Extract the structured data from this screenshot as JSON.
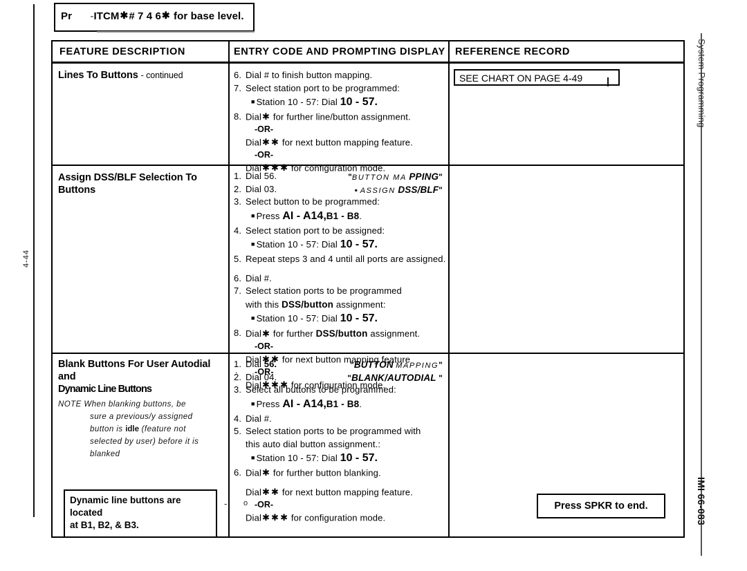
{
  "document": {
    "running_head": "System Programming",
    "doc_code": "IMI 66-083",
    "page_marker": "4-44"
  },
  "top_callout": {
    "prefix": "Pr",
    "faded": "‐",
    "text": "ITCM",
    "code": "# 7 4 6",
    "suffix": "for base level."
  },
  "table": {
    "headers": {
      "feature": "FEATURE DESCRIPTION",
      "entry": "ENTRY CODE AND PROMPTING DISPLAY",
      "reference": "REFERENCE RECORD"
    },
    "rows": [
      {
        "feature_title": "Lines To Buttons",
        "feature_suffix": "- continued",
        "steps": [
          {
            "num": "6.",
            "text": "Dial # to finish button mapping."
          },
          {
            "num": "7.",
            "text": "Select station port to be programmed:"
          },
          {
            "sub": "Station 10 - 57: Dial",
            "sub_big": "10 - 57."
          },
          {
            "num": "8.",
            "pre": "Dial",
            "ast": 1,
            "post": "for further line/button assignment."
          },
          {
            "or": "-OR-"
          },
          {
            "cont_pre": "Dial",
            "cont_ast": 2,
            "cont_post": "for next button mapping feature."
          },
          {
            "or": "-OR-"
          },
          {
            "cont_pre": "Dial",
            "cont_ast": 3,
            "cont_post": "for configuration mode."
          }
        ],
        "reference": "SEE CHART ON PAGE 4-49"
      },
      {
        "feature_title": "Assign DSS/BLF Selection To Buttons",
        "steps": [
          {
            "num": "1.",
            "text": "Dial 56.",
            "prompt_quote": "\"",
            "prompt_small": "BUTTON MA",
            "prompt_large": "PPING",
            "prompt_quote2": "\""
          },
          {
            "num": "2.",
            "text": "Dial 03.",
            "prompt_quote": "▪",
            "prompt_small": "ASSIGN",
            "prompt_large": "DSS/BLF",
            "prompt_quote2": "\""
          },
          {
            "num": "3.",
            "text": "Select button to be programmed:"
          },
          {
            "sub_press": "Press",
            "sub_big2": "AI - A14,",
            "sub_bold": "B1 - B8",
            "sub_end": "."
          },
          {
            "num": "4.",
            "text": "Select station port to be assigned:"
          },
          {
            "sub": "Station 10 - 57: Dial",
            "sub_big": "10 - 57."
          },
          {
            "num": "5.",
            "text": "Repeat steps 3 and 4 until all ports are assigned."
          },
          {
            "spacer": true
          },
          {
            "num": "6.",
            "text": "Dial #."
          },
          {
            "num": "7.",
            "text": "Select station ports to be programmed"
          },
          {
            "cont2_pre": "with this",
            "cont2_bold": "DSS/button",
            "cont2_post": "assignment:"
          },
          {
            "sub": "Station 10 - 57: Dial",
            "sub_big": "10 - 57."
          },
          {
            "num": "8.",
            "pre": "Dial",
            "ast": 1,
            "mid_bold": "DSS/button",
            "post_b": "for further",
            "post": "assignment."
          },
          {
            "or": "-OR-"
          },
          {
            "cont_pre": "Dial",
            "cont_ast": 2,
            "cont_post": "for next button mapping feature"
          },
          {
            "or_dot": "-OR-"
          },
          {
            "cont_pre": "Dial",
            "cont_ast": 3,
            "cont_post": "for configuration mode."
          }
        ],
        "reference": ""
      },
      {
        "feature_title_line1": "Blank Buttons For User Autodial and",
        "feature_title_line2": "Dynamic Line Buttons",
        "note": {
          "label": "NOTE",
          "line1": "When blanking buttons, be",
          "line2": "sure a previous/y assigned",
          "line3_pre": "button is",
          "line3_bold": "idle",
          "line3_post": "(feature not",
          "line4": "selected by user) before it is",
          "line5": "blanked"
        },
        "box_note_line1": "Dynamic line buttons are located",
        "box_note_line2": "at B1, B2, & B3.",
        "steps": [
          {
            "num": "1.",
            "pre_plain": "Dial",
            "bold_val": "56.",
            "prompt_quote": "\"",
            "prompt_large": "BUTTON",
            "prompt_small": "MAPPING",
            "prompt_quote2": "\""
          },
          {
            "num": "2.",
            "text": "Dial 04.",
            "prompt_quote": "\"",
            "prompt_large": "BLANK/AUTODIAL",
            "prompt_quote2": "\""
          },
          {
            "num": "3.",
            "text": "Select all buttons to be programmed:"
          },
          {
            "sub_press": "Press",
            "sub_big2": "AI - A14,",
            "sub_bold": "B1 - B8",
            "sub_end": "."
          },
          {
            "num": "4.",
            "text": "Dial #."
          },
          {
            "num": "5.",
            "text": "Select station ports to be programmed with"
          },
          {
            "cont3": "this auto dial button assignment.:"
          },
          {
            "sub": "Station 10 - 57: Dial",
            "sub_big": "10 - 57."
          },
          {
            "num": "6.",
            "pre": "Dial",
            "ast": 1,
            "post": "for further button blanking."
          },
          {
            "spacer": true
          },
          {
            "cont_pre": "Dial",
            "cont_ast": 2,
            "cont_post": "for next button mapping feature."
          },
          {
            "or": "-OR-"
          },
          {
            "cont_pre": "Dial",
            "cont_ast": 3,
            "cont_post": "for configuration mode."
          }
        ],
        "reference": ""
      }
    ],
    "spkr_note": "Press SPKR to end."
  }
}
